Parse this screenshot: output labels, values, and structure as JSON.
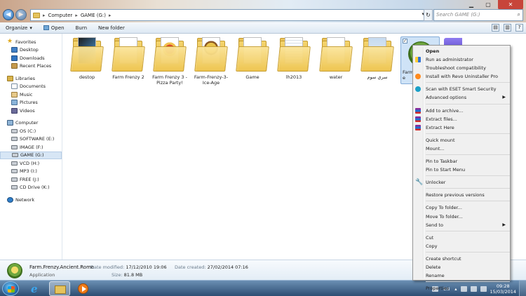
{
  "address_bar": {
    "crumbs": [
      "Computer",
      "GAME (G:)"
    ],
    "search_placeholder": "Search GAME (G:)"
  },
  "toolbar": {
    "organize": "Organize",
    "open": "Open",
    "burn": "Burn",
    "new_folder": "New folder"
  },
  "nav": {
    "favorites": "Favorites",
    "favorite_items": [
      "Desktop",
      "Downloads",
      "Recent Places"
    ],
    "libraries": "Libraries",
    "library_items": [
      "Documents",
      "Music",
      "Pictures",
      "Videos"
    ],
    "computer": "Computer",
    "drives": [
      "OS (C:)",
      "SOFTWARE (E:)",
      "IMAGE (F:)",
      "GAME (G:)",
      "VCD (H:)",
      "MP3 (I:)",
      "FREE (J:)",
      "CD Drive (K:)"
    ],
    "selected_drive": "GAME (G:)",
    "network": "Network"
  },
  "files": [
    {
      "name": "destop",
      "art": "dark"
    },
    {
      "name": "Farm Frenzy 2",
      "art": "plain"
    },
    {
      "name": "Farm Frenzy 3 - Pizza Party!",
      "art": "pizza"
    },
    {
      "name": "Farm-Frenzy-3-Ice-Age",
      "art": "farm"
    },
    {
      "name": "Game",
      "art": "plain"
    },
    {
      "name": "lh2013",
      "art": "doc"
    },
    {
      "name": "water",
      "art": "plain"
    },
    {
      "name": "سري سوم",
      "art": "img"
    }
  ],
  "selected_file": {
    "label_fragment": "Farm",
    "label_fragment2": "e"
  },
  "context_menu": [
    {
      "label": "Open",
      "bold": true,
      "icon": ""
    },
    {
      "label": "Run as administrator",
      "icon": "shield"
    },
    {
      "label": "Troubleshoot compatibility",
      "icon": ""
    },
    {
      "label": "Install with Revo Uninstaller Pro",
      "icon": "revo"
    },
    {
      "sep": true
    },
    {
      "label": "Scan with ESET Smart Security",
      "icon": "eset"
    },
    {
      "label": "Advanced options",
      "icon": "",
      "submenu": true
    },
    {
      "sep": true
    },
    {
      "label": "Add to archive...",
      "icon": "rar"
    },
    {
      "label": "Extract files...",
      "icon": "rar"
    },
    {
      "label": "Extract Here",
      "icon": "rar"
    },
    {
      "sep": true
    },
    {
      "label": "Quick mount",
      "icon": ""
    },
    {
      "label": "Mount...",
      "icon": ""
    },
    {
      "sep": true
    },
    {
      "label": "Pin to Taskbar",
      "icon": ""
    },
    {
      "label": "Pin to Start Menu",
      "icon": ""
    },
    {
      "sep": true
    },
    {
      "label": "Unlocker",
      "icon": "unlock"
    },
    {
      "sep": true
    },
    {
      "label": "Restore previous versions",
      "icon": ""
    },
    {
      "sep": true
    },
    {
      "label": "Copy To folder...",
      "icon": ""
    },
    {
      "label": "Move To folder...",
      "icon": ""
    },
    {
      "label": "Send to",
      "icon": "",
      "submenu": true
    },
    {
      "sep": true
    },
    {
      "label": "Cut",
      "icon": ""
    },
    {
      "label": "Copy",
      "icon": ""
    },
    {
      "sep": true
    },
    {
      "label": "Create shortcut",
      "icon": ""
    },
    {
      "label": "Delete",
      "icon": ""
    },
    {
      "label": "Rename",
      "icon": ""
    },
    {
      "sep": true
    },
    {
      "label": "Properties",
      "icon": ""
    }
  ],
  "details": {
    "name": "Farm.Frenzy.Ancient.Rome",
    "type": "Application",
    "modified_label": "Date modified:",
    "modified_value": "17/12/2010 19:06",
    "size_label": "Size:",
    "size_value": "81.8 MB",
    "created_label": "Date created:",
    "created_value": "27/02/2014 07:16"
  },
  "tray": {
    "lang": "EN",
    "time": "09:28",
    "date": "15/03/2014"
  }
}
